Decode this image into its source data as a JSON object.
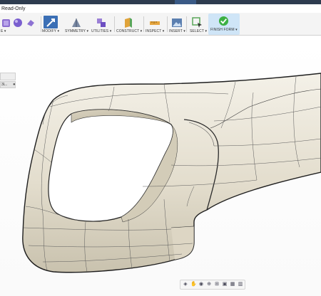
{
  "window": {
    "status": "Read-Only"
  },
  "toolbar": {
    "groups": [
      {
        "label": "E ▾"
      },
      {
        "label": "MODIFY ▾"
      },
      {
        "label": "SYMMETRY ▾"
      },
      {
        "label": "UTILITIES ▾"
      },
      {
        "label": "CONSTRUCT ▾"
      },
      {
        "label": "INSPECT ▾"
      },
      {
        "label": "INSERT ▾"
      },
      {
        "label": "SELECT ▾"
      },
      {
        "label": "FINISH FORM ▾"
      }
    ]
  },
  "browser": {
    "tab1": "",
    "tab2": "3L.."
  },
  "colors": {
    "accent": "#3a5a86",
    "finish_bg": "#cfe5f7",
    "finish_icon": "#3cb043",
    "model": "#e6e1d3"
  },
  "navbar": {
    "icons": [
      "orbit-icon",
      "pan-icon",
      "look-icon",
      "zoom-icon",
      "fit-icon",
      "display-icon",
      "grid-icon",
      "viewports-icon"
    ]
  }
}
